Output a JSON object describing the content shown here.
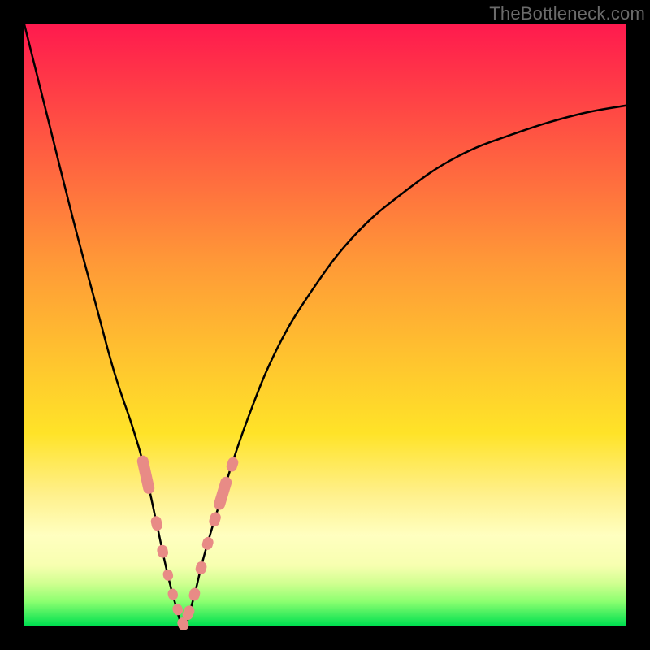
{
  "watermark": "TheBottleneck.com",
  "colors": {
    "frame_bg": "#000000",
    "gradient_top": "#ff1a4e",
    "gradient_bottom": "#00e050",
    "curve_stroke": "#000000",
    "pill_fill": "#e88b86",
    "pill_stroke": "#c96a64"
  },
  "chart_data": {
    "type": "line",
    "title": "",
    "xlabel": "",
    "ylabel": "",
    "xlim": [
      0,
      100
    ],
    "ylim": [
      0,
      100
    ],
    "x": [
      0,
      4,
      8,
      12,
      15,
      18,
      20,
      22,
      23.5,
      25,
      26.5,
      28,
      30,
      33,
      37,
      42,
      48,
      55,
      63,
      72,
      82,
      92,
      100
    ],
    "y": [
      100,
      84,
      68,
      53,
      42,
      33,
      26,
      17,
      10,
      4,
      0,
      4,
      12,
      22,
      34,
      46,
      56,
      65,
      72,
      78,
      82,
      85,
      86.5
    ],
    "notes": "V-shaped bottleneck curve; valley minimum near x≈26. Left branch is steeper than the right. Axes have no visible tick labels; values are normalized 0–100 estimates from the plot area.",
    "markers": {
      "type": "rounded-pill",
      "count": 14,
      "x_span": [
        20,
        34
      ],
      "description": "Salmon-colored rounded segments clustered along both branches of the curve near the valley."
    }
  }
}
